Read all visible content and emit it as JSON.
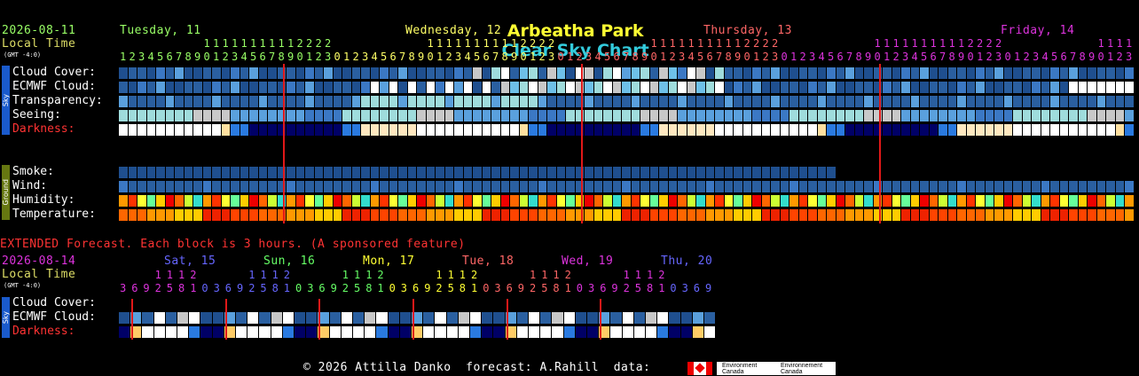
{
  "title": {
    "part1": "Arbeatha Park",
    "part2": "Clear Sky Chart",
    "color1": "#ffff33",
    "color2": "#33ccdd"
  },
  "main": {
    "date": "2026-08-11",
    "local_time": "Local Time",
    "gmt": "(GMT -4:0)",
    "days": [
      {
        "label": "Tuesday, 11",
        "color": "#99ff66"
      },
      {
        "label": "Wednesday, 12",
        "color": "#ffff66"
      },
      {
        "label": "Thursday, 13",
        "color": "#ff6666"
      },
      {
        "label": "Friday, 14",
        "color": "#dd33dd"
      }
    ],
    "rows": [
      "Cloud Cover:",
      "ECMWF Cloud:",
      "Transparency:",
      "Seeing:",
      "Darkness:"
    ],
    "ground_rows": [
      "Smoke:",
      "Wind:",
      "Humidity:",
      "Temperature:"
    ],
    "sky_tab": "Sky",
    "ground_tab": "Ground"
  },
  "extended": {
    "banner": "EXTENDED Forecast. Each block is 3 hours. (A sponsored feature)",
    "date": "2026-08-14",
    "local_time": "Local Time",
    "gmt": "(GMT -4:0)",
    "days": [
      {
        "label": "Sat, 15",
        "color": "#6666ff"
      },
      {
        "label": "Sun, 16",
        "color": "#66ff66"
      },
      {
        "label": "Mon, 17",
        "color": "#ffff33"
      },
      {
        "label": "Tue, 18",
        "color": "#ff6666"
      },
      {
        "label": "Wed, 19",
        "color": "#dd33dd"
      },
      {
        "label": "Thu, 20",
        "color": "#6666ff"
      }
    ],
    "rows": [
      "Cloud Cover:",
      "ECMWF Cloud:",
      "Darkness:"
    ],
    "sky_tab": "Sky"
  },
  "footer": {
    "text": "© 2026 Attilla Danko  forecast: A.Rahill  data:",
    "env1": "Environment Canada",
    "env2": "Environnement Canada"
  },
  "colors": {
    "label": "#ffffff",
    "darkness_label": "#ff3333",
    "banner": "#ff3333",
    "red_line": "#dd1111"
  }
}
